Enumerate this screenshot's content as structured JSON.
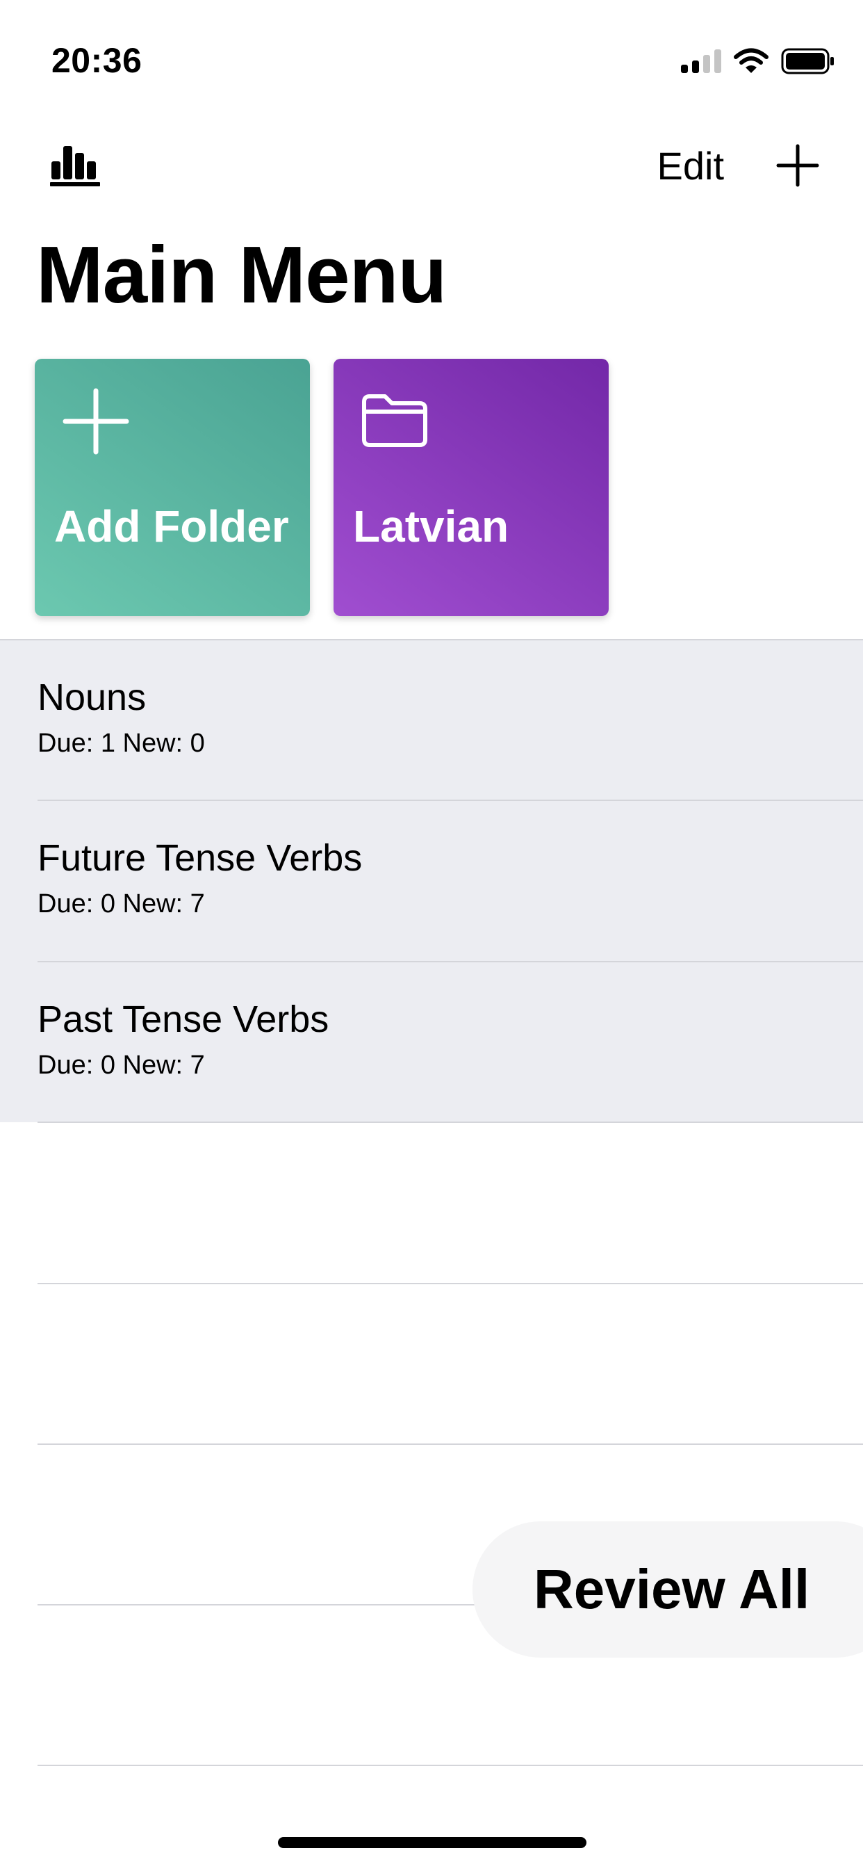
{
  "status_bar": {
    "time": "20:36",
    "icons": [
      "signal-icon",
      "wifi-icon",
      "battery-icon"
    ]
  },
  "nav": {
    "stats_icon": "bar-chart-icon",
    "edit_label": "Edit",
    "add_icon": "plus-icon"
  },
  "page": {
    "title": "Main Menu"
  },
  "folders": [
    {
      "label": "Add Folder",
      "icon": "plus-icon",
      "colors": [
        "#4aa393",
        "#6cc8b0"
      ]
    },
    {
      "label": "Latvian",
      "icon": "folder-icon",
      "colors": [
        "#7328a8",
        "#a04ed0"
      ]
    }
  ],
  "decks": [
    {
      "title": "Nouns",
      "stats": "Due: 1 New: 0"
    },
    {
      "title": "Future Tense Verbs",
      "stats": "Due: 0 New: 7"
    },
    {
      "title": "Past Tense Verbs",
      "stats": "Due: 0 New: 7"
    }
  ],
  "review_all": {
    "label": "Review All"
  },
  "colors": {
    "list_background": "#ecedf2",
    "separator": "#d4d5da",
    "review_button_bg": "#f5f5f6"
  }
}
